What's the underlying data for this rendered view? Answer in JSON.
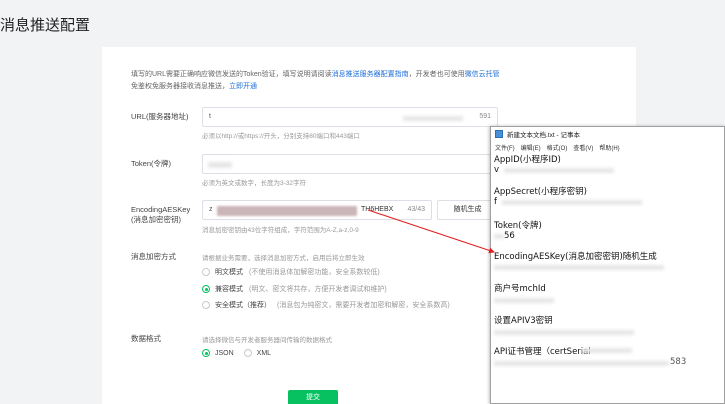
{
  "page": {
    "title": "消息推送配置"
  },
  "description": {
    "text_a": "填写的URL需要正确响应微信发送的Token验证，填写说明请阅读",
    "link_guide": "消息推送服务器配置指南",
    "text_b": "，开发者也可使用",
    "link_cloud": "微信云托管",
    "text_c": "免鉴权免服务器接收消息推送，",
    "link_open": "立即开通"
  },
  "url_field": {
    "label": "URL(服务器地址)",
    "value": "t",
    "tail": "591",
    "hint": "必须以http://或https://开头，分别支持80端口和443端口"
  },
  "token_field": {
    "label": "Token(令牌)",
    "hint": "必须为英文或数字，长度为3-32字符"
  },
  "aes_field": {
    "label": "EncodingAESKey",
    "label_sub": "(消息加密密钥)",
    "value_prefix": "z",
    "value_tail": "TH6HEBX",
    "counter": "43/43",
    "button": "随机生成",
    "hint": "消息加密密钥由43位字符组成，字符范围为A-Z,a-z,0-9"
  },
  "encrypt": {
    "label": "消息加密方式",
    "hint": "请根据业务需要，选择消息加密方式，启用后将立即生效",
    "options": [
      {
        "label": "明文模式",
        "sub": "(不使用消息体加解密功能，安全系数较低)"
      },
      {
        "label": "兼容模式",
        "sub": "(明文、密文将共存，方便开发者调试和维护)"
      },
      {
        "label": "安全模式（推荐）",
        "sub": "(消息包为纯密文，需要开发者加密和解密，安全系数高)"
      }
    ],
    "selected_index": 1
  },
  "data_format": {
    "label": "数据格式",
    "hint": "请选择微信与开发者服务器间传输的数据格式",
    "options": [
      "JSON",
      "XML"
    ],
    "selected": "JSON"
  },
  "submit_label": "提交",
  "notepad": {
    "title": "新建文本文档.txt - 记事本",
    "menu": [
      "文件(F)",
      "编辑(E)",
      "格式(O)",
      "查看(V)",
      "帮助(H)"
    ],
    "lines": {
      "appid": "AppID(小程序ID)",
      "appid_val": "v",
      "secret": "AppSecret(小程序密钥)",
      "secret_val": "f",
      "token": "Token(令牌)",
      "token_val": "56",
      "aes": "EncodingAESKey(消息加密密钥)随机生成",
      "mchid": "商户号mchId",
      "apiv3": "设置APIV3密钥",
      "cert": "API证书管理（certSerial",
      "cert_tail": "583"
    }
  },
  "colors": {
    "accent": "#07c160",
    "link": "#1e6fd9",
    "arrow": "#e02020"
  }
}
